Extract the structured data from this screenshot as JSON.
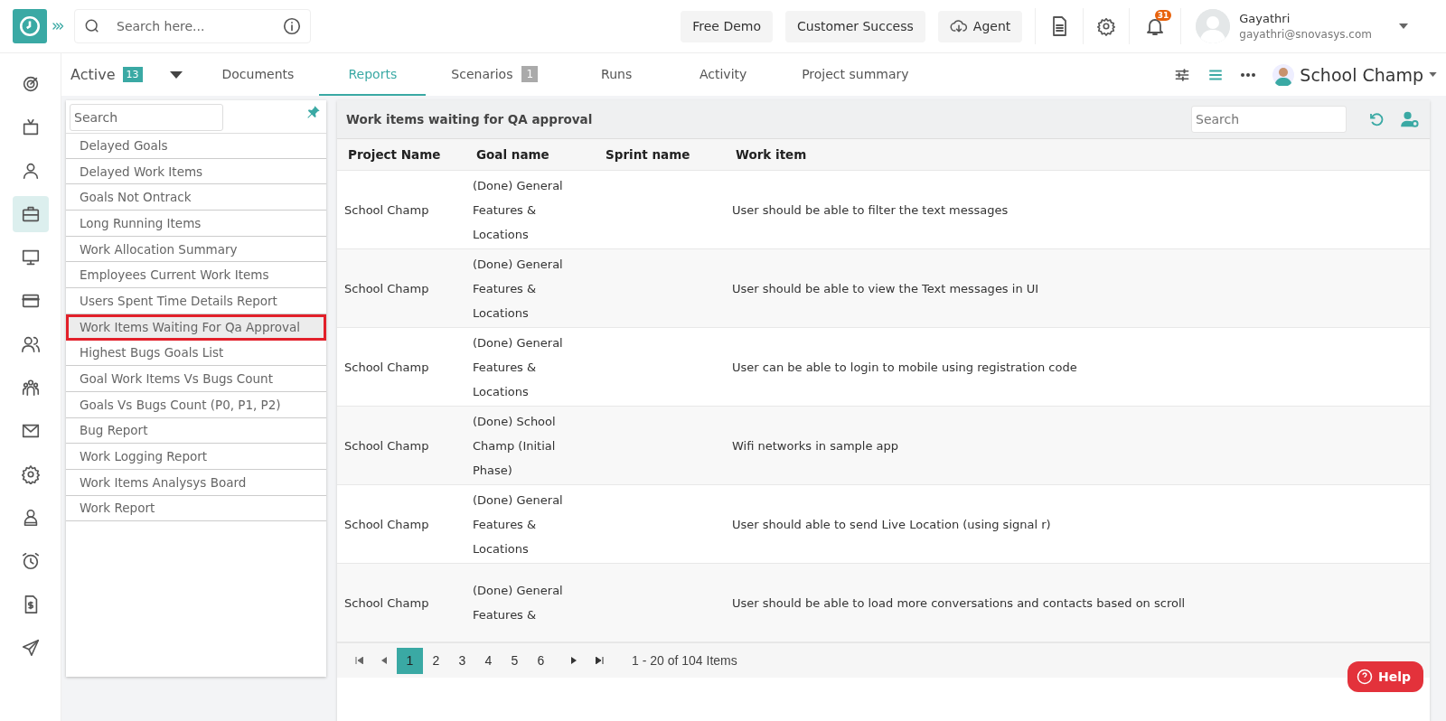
{
  "header": {
    "search": {
      "placeholder": "Search here..."
    },
    "buttons": [
      {
        "label": "Free Demo",
        "kind": "plain"
      },
      {
        "label": "Customer Success",
        "kind": "plain"
      },
      {
        "label": "Agent",
        "kind": "cloud"
      }
    ],
    "notifications": "31",
    "user": {
      "name": "Gayathri",
      "email": "gayathri@snovasys.com"
    }
  },
  "sidebar": {
    "items": [
      {
        "selected": false
      },
      {
        "selected": false
      },
      {
        "selected": false
      },
      {
        "selected": true
      },
      {
        "selected": false
      },
      {
        "selected": false
      },
      {
        "selected": false
      },
      {
        "selected": false
      },
      {
        "selected": false
      },
      {
        "selected": false
      },
      {
        "selected": false
      },
      {
        "selected": false
      },
      {
        "selected": false
      },
      {
        "selected": false
      }
    ]
  },
  "status_filter": {
    "label": "Active",
    "count": "13"
  },
  "tabs": [
    {
      "label": "Documents",
      "selected": false
    },
    {
      "label": "Reports",
      "selected": true
    },
    {
      "label": "Scenarios",
      "badge": "1",
      "selected": false
    },
    {
      "label": "Runs",
      "selected": false
    },
    {
      "label": "Activity",
      "selected": false
    },
    {
      "label": "Project summary",
      "selected": false
    }
  ],
  "project": {
    "name": "School Champ"
  },
  "reports": {
    "search": {
      "placeholder": "Search"
    },
    "items": [
      {
        "label": "Delayed Goals",
        "selected": false
      },
      {
        "label": "Delayed Work Items",
        "selected": false
      },
      {
        "label": "Goals Not Ontrack",
        "selected": false
      },
      {
        "label": "Long Running Items",
        "selected": false
      },
      {
        "label": "Work Allocation Summary",
        "selected": false
      },
      {
        "label": "Employees Current Work Items",
        "selected": false
      },
      {
        "label": "Users Spent Time Details Report",
        "selected": false
      },
      {
        "label": "Work Items Waiting For Qa Approval",
        "selected": true
      },
      {
        "label": "Highest Bugs Goals List",
        "selected": false
      },
      {
        "label": "Goal Work Items Vs Bugs Count",
        "selected": false
      },
      {
        "label": "Goals Vs Bugs Count (P0, P1, P2)",
        "selected": false
      },
      {
        "label": "Bug Report",
        "selected": false
      },
      {
        "label": "Work Logging Report",
        "selected": false
      },
      {
        "label": "Work Items Analysys Board",
        "selected": false
      },
      {
        "label": "Work Report",
        "selected": false
      }
    ]
  },
  "table": {
    "title": "Work items waiting for QA approval",
    "search": {
      "placeholder": "Search"
    },
    "columns": [
      "Project Name",
      "Goal name",
      "Sprint name",
      "Work item"
    ],
    "rows": [
      [
        "School Champ",
        "(Done) General Features & Locations",
        "",
        "User should be able to filter the text messages"
      ],
      [
        "School Champ",
        "(Done) General Features & Locations",
        "",
        "User should be able to view the Text messages in UI"
      ],
      [
        "School Champ",
        "(Done) General Features & Locations",
        "",
        "User can be able to login to mobile using registration code"
      ],
      [
        "School Champ",
        "(Done) School Champ (Initial Phase)",
        "",
        "Wifi networks in sample app"
      ],
      [
        "School Champ",
        "(Done) General Features & Locations",
        "",
        "User should able to send Live Location (using signal r)"
      ],
      [
        "School Champ",
        "(Done) General Features &",
        "",
        "User should be able to load more conversations and contacts based on scroll"
      ]
    ]
  },
  "pagination": {
    "pages": [
      {
        "label": "1",
        "selected": true
      },
      {
        "label": "2",
        "selected": false
      },
      {
        "label": "3",
        "selected": false
      },
      {
        "label": "4",
        "selected": false
      },
      {
        "label": "5",
        "selected": false
      },
      {
        "label": "6",
        "selected": false
      }
    ],
    "summary": "1 - 20 of 104 Items"
  },
  "help": {
    "label": "Help"
  }
}
